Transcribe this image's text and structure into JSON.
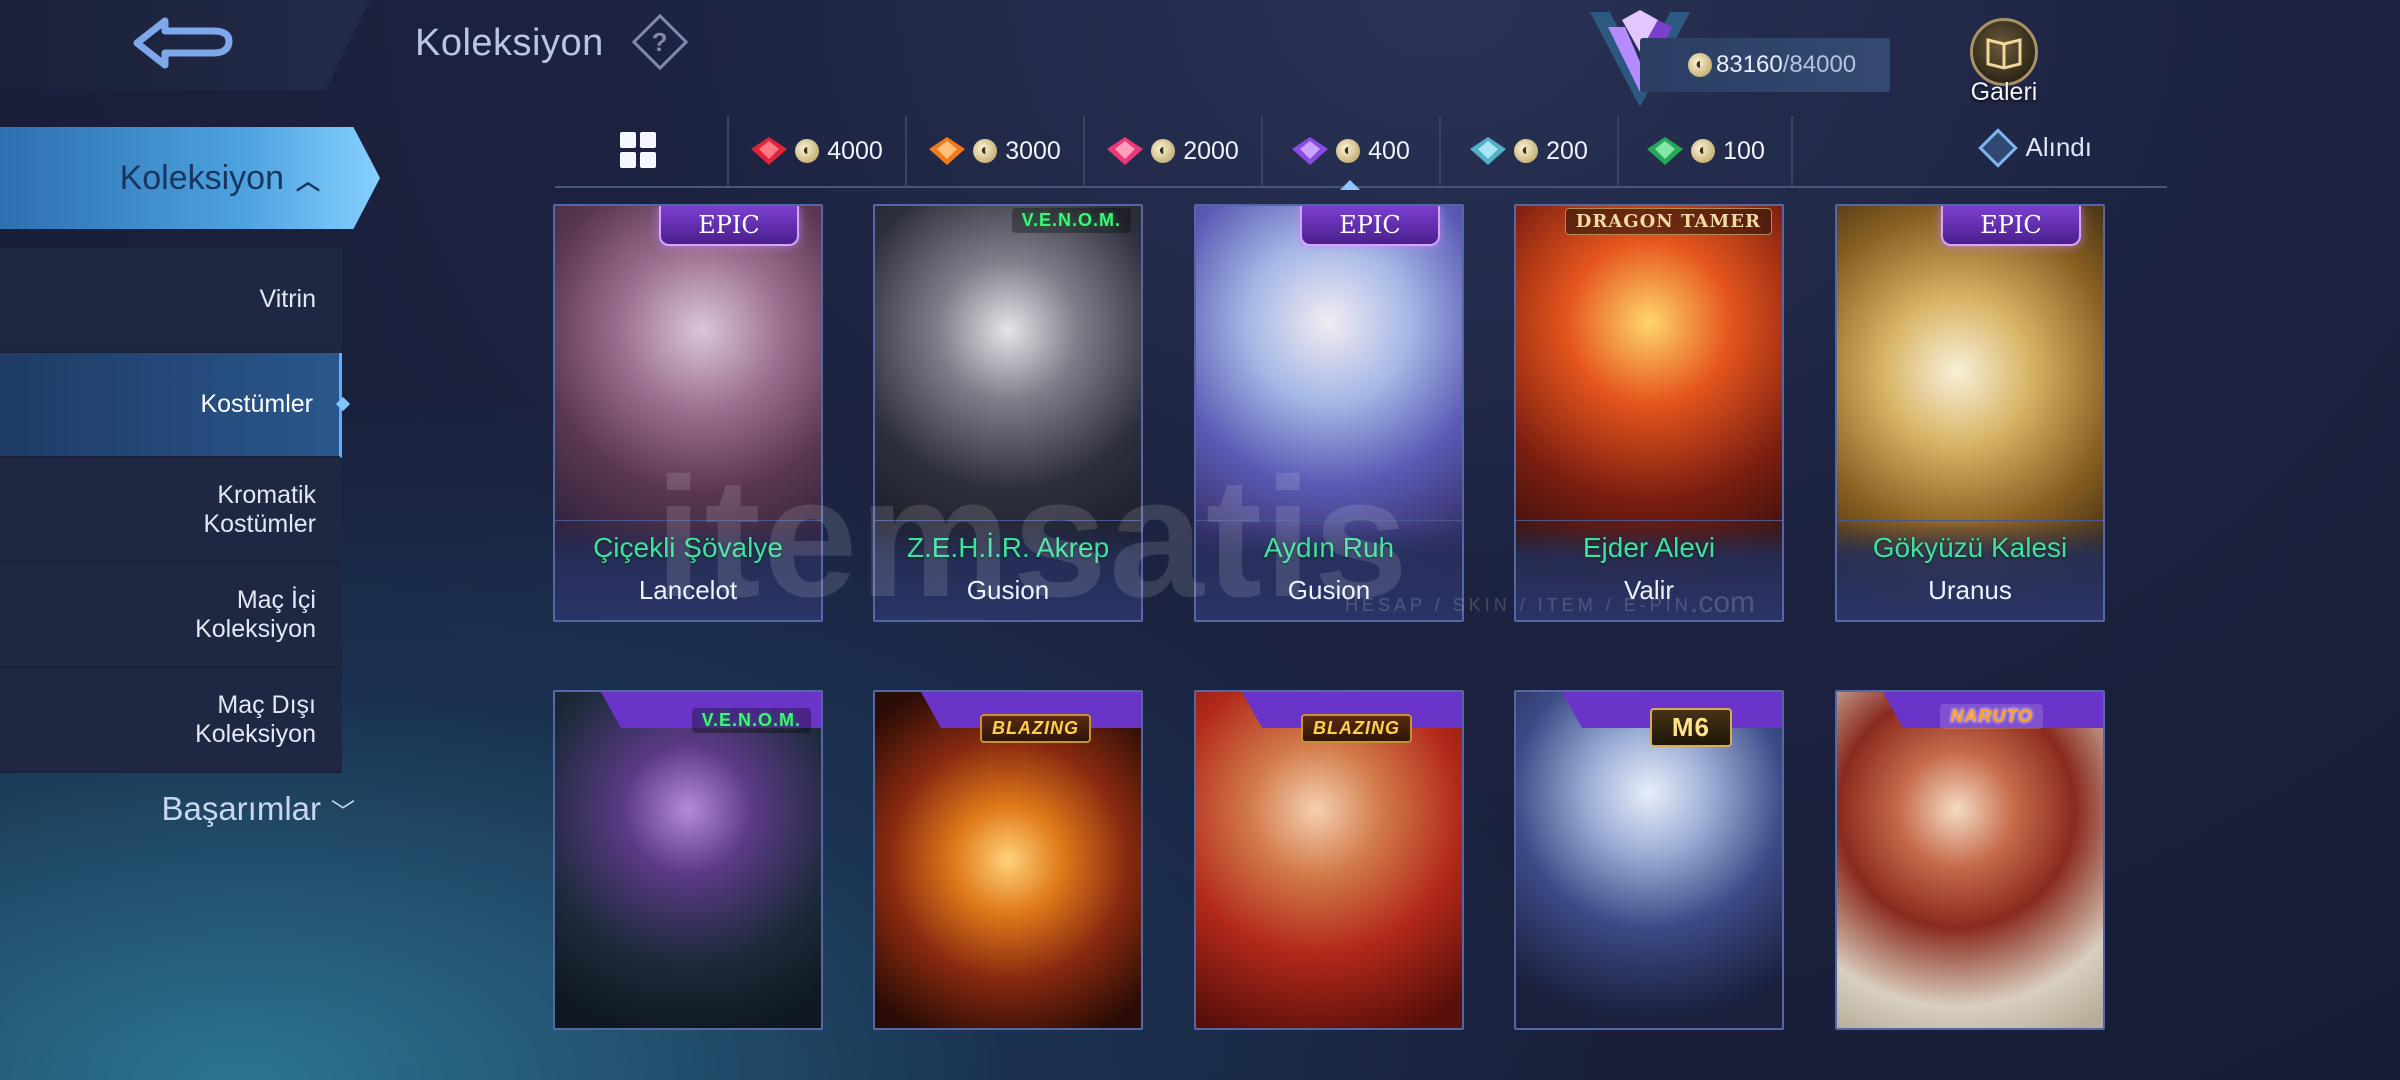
{
  "header": {
    "title": "Koleksiyon",
    "help_symbol": "?",
    "back_icon": "back-arrow-icon",
    "points_current": "83160",
    "points_max": "/84000",
    "gallery_label": "Galeri"
  },
  "sidebar": {
    "header": "Koleksiyon",
    "items": [
      {
        "label": "Vitrin"
      },
      {
        "label": "Kostümler"
      },
      {
        "label": "Kromatik\nKostümler"
      },
      {
        "label": "Maç İçi\nKoleksiyon"
      },
      {
        "label": "Maç Dışı\nKoleksiyon"
      }
    ],
    "active_index": 1,
    "achievements": "Başarımlar"
  },
  "filters": {
    "tabs": [
      {
        "value": "4000",
        "color": "#e0243a"
      },
      {
        "value": "3000",
        "color": "#f07a1d"
      },
      {
        "value": "2000",
        "color": "#e83a78"
      },
      {
        "value": "400",
        "color": "#8a4be0"
      },
      {
        "value": "200",
        "color": "#4fb0c8"
      },
      {
        "value": "100",
        "color": "#24a85a"
      }
    ],
    "active_index": 3,
    "owned_label": "Alındı"
  },
  "cards_row1": [
    {
      "skin": "Çiçekli Şövalye",
      "hero": "Lancelot",
      "tag": "EPIC"
    },
    {
      "skin": "Z.E.H.İ.R. Akrep",
      "hero": "Gusion",
      "logo": "V.E.N.O.M."
    },
    {
      "skin": "Aydın Ruh",
      "hero": "Gusion",
      "tag": "EPIC"
    },
    {
      "skin": "Ejder Alevi",
      "hero": "Valir",
      "logo": "DRAGON TAMER"
    },
    {
      "skin": "Gökyüzü Kalesi",
      "hero": "Uranus",
      "tag": "EPIC"
    }
  ],
  "cards_row2": [
    {
      "logo": "V.E.N.O.M."
    },
    {
      "logo": "BLAZING"
    },
    {
      "logo": "BLAZING"
    },
    {
      "logo": "M6"
    },
    {
      "logo": "NARUTO"
    }
  ],
  "watermark": {
    "main": "itemsatis",
    "sub": "HESAP / SKIN / ITEM / E-PIN",
    "com": ".com"
  },
  "colors": {
    "accent": "#4ea3e0",
    "skin_name": "#3fe0a0",
    "epic": "#7b3fcf"
  }
}
